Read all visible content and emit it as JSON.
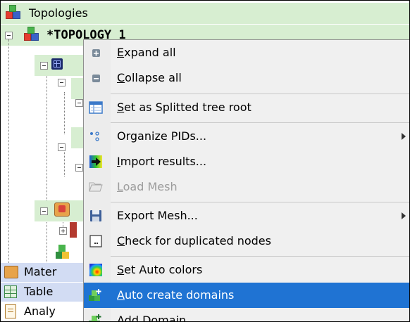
{
  "tree": {
    "root_label": "Topologies",
    "topology_label": "*TOPOLOGY 1",
    "bottom_items": [
      {
        "label": "Mater",
        "icon": "materials-icon"
      },
      {
        "label": "Table",
        "icon": "table-icon"
      },
      {
        "label": "Analy",
        "icon": "analysis-icon"
      }
    ]
  },
  "context_menu": {
    "items": [
      {
        "pre": "",
        "mn": "E",
        "post": "xpand all",
        "icon": "expand-all-icon",
        "enabled": true,
        "submenu": false
      },
      {
        "pre": "",
        "mn": "C",
        "post": "ollapse all",
        "icon": "collapse-all-icon",
        "enabled": true,
        "submenu": false
      },
      {
        "pre": "",
        "mn": "S",
        "post": "et as Splitted tree root",
        "icon": "split-tree-icon",
        "enabled": true,
        "submenu": false
      },
      {
        "pre": "Organize PIDs...",
        "mn": "",
        "post": "",
        "icon": "organize-pids-icon",
        "enabled": true,
        "submenu": true
      },
      {
        "pre": "",
        "mn": "I",
        "post": "mport results...",
        "icon": "import-results-icon",
        "enabled": true,
        "submenu": false
      },
      {
        "pre": "",
        "mn": "L",
        "post": "oad Mesh",
        "icon": "load-mesh-icon",
        "enabled": false,
        "submenu": false
      },
      {
        "pre": "Export Mesh...",
        "mn": "",
        "post": "",
        "icon": "export-mesh-icon",
        "enabled": true,
        "submenu": true
      },
      {
        "pre": "",
        "mn": "C",
        "post": "heck for duplicated nodes",
        "icon": "check-duplicates-icon",
        "enabled": true,
        "submenu": false
      },
      {
        "pre": "",
        "mn": "S",
        "post": "et Auto colors",
        "icon": "auto-colors-icon",
        "enabled": true,
        "submenu": false
      },
      {
        "pre": "",
        "mn": "A",
        "post": "uto create domains",
        "icon": "auto-create-domains-icon",
        "enabled": true,
        "submenu": false,
        "selected": true
      },
      {
        "pre": "",
        "mn": "A",
        "post": "dd Domain...",
        "icon": "add-domain-icon",
        "enabled": true,
        "submenu": false
      }
    ]
  }
}
